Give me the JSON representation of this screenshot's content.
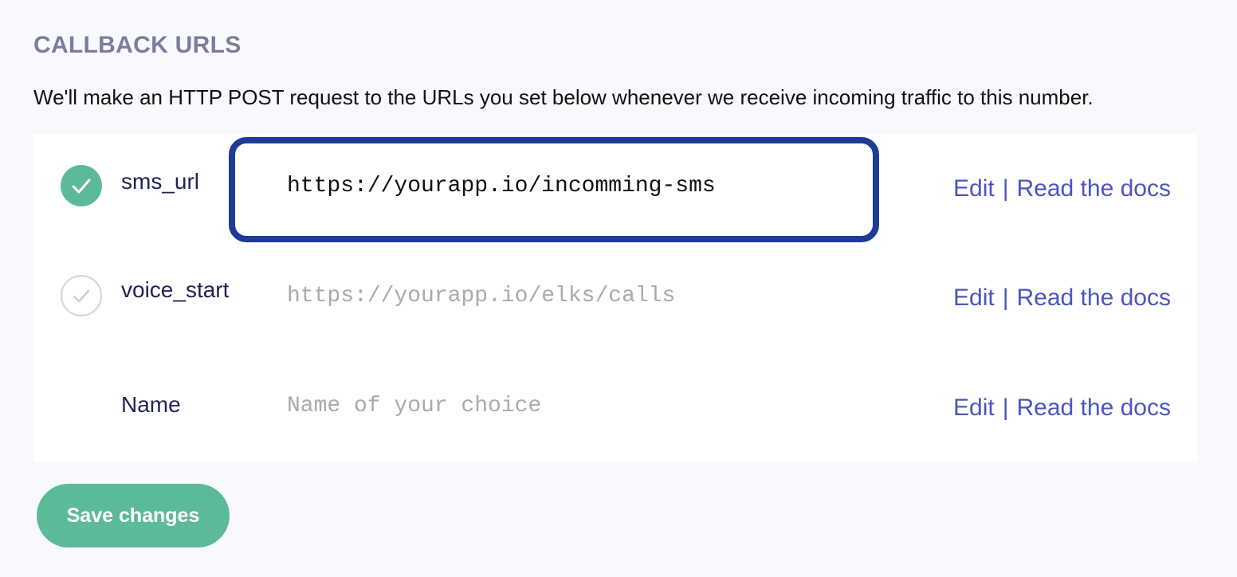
{
  "section": {
    "title": "CALLBACK URLS",
    "description": "We'll make an HTTP POST request to the URLs you set below whenever we receive incoming traffic to this number."
  },
  "fields": [
    {
      "label": "sms_url",
      "value": "https://yourapp.io/incomming-sms",
      "placeholder": "",
      "checked": true,
      "edit_label": "Edit",
      "separator": "|",
      "docs_label": "Read the docs"
    },
    {
      "label": "voice_start",
      "value": "",
      "placeholder": "https://yourapp.io/elks/calls",
      "checked": false,
      "edit_label": "Edit",
      "separator": "|",
      "docs_label": "Read the docs"
    },
    {
      "label": "Name",
      "value": "",
      "placeholder": "Name of your choice",
      "edit_label": "Edit",
      "separator": "|",
      "docs_label": "Read the docs"
    }
  ],
  "save_button": {
    "label": "Save changes"
  },
  "colors": {
    "accent_green": "#5dba98",
    "link_blue": "#4c55bf",
    "highlight_border": "#1d3b97",
    "title_gray": "#7b7d9c",
    "label_navy": "#1e2256"
  },
  "icons": {
    "checked": "check-circle-filled-icon",
    "unchecked": "check-circle-outline-icon"
  }
}
